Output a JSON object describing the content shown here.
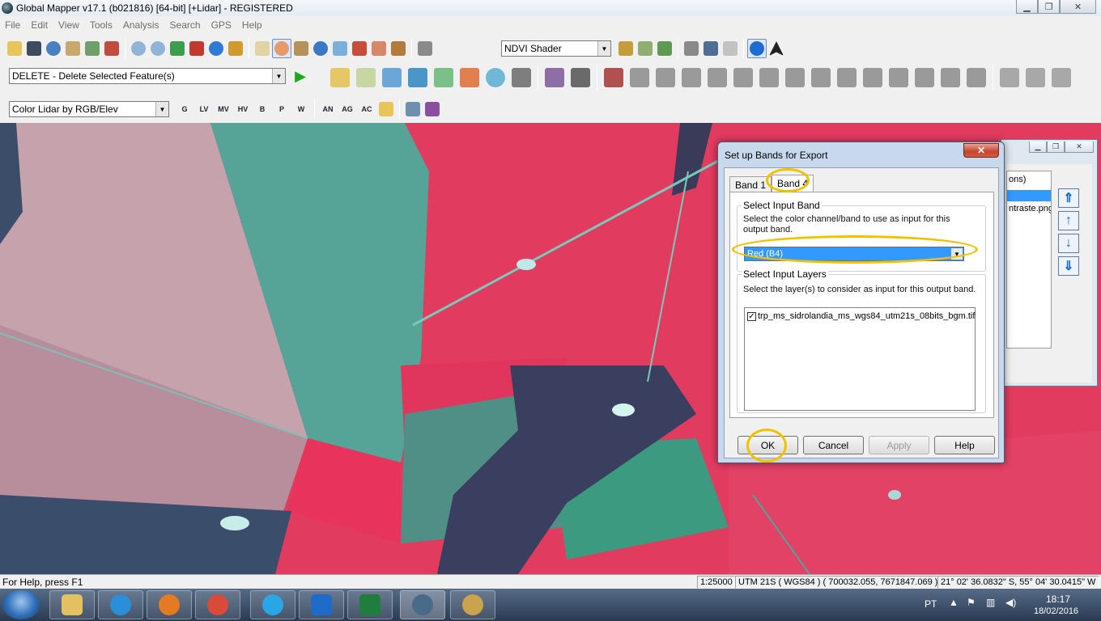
{
  "window": {
    "title": "Global Mapper v17.1 (b021816) [64-bit] [+Lidar] - REGISTERED",
    "minimize_glyph": "▁",
    "restore_glyph": "❐",
    "close_glyph": "✕"
  },
  "menu": [
    "File",
    "Edit",
    "View",
    "Tools",
    "Analysis",
    "Search",
    "GPS",
    "Help"
  ],
  "toolbar": {
    "shader_select": "NDVI Shader",
    "digitizer_select": "DELETE - Delete Selected Feature(s)",
    "lidar_select": "Color Lidar by RGB/Elev",
    "run_label": "▶",
    "lidar_buttons": [
      "G",
      "LV",
      "MV",
      "HV",
      "B",
      "P",
      "W"
    ],
    "lidar_buttons_2": [
      "AN",
      "AG",
      "AC"
    ]
  },
  "status": {
    "help": "For Help, press F1",
    "scale": "1:25000",
    "projection": "UTM 21S ( WGS84 ) ( 700032.055, 7671847.069 )",
    "latlon": "21° 02' 36.0832\" S, 55° 04' 30.0415\" W"
  },
  "background_window": {
    "col_text": "ons)",
    "item_text": "ntraste.png"
  },
  "dialog": {
    "title": "Set up Bands for Export",
    "close_glyph": "✕",
    "tabs": [
      "Band 1",
      "Band 4"
    ],
    "input_band": {
      "label": "Select Input Band",
      "description": "Select the color channel/band to use as input for this output band.",
      "selected": "Red (B4)"
    },
    "input_layers": {
      "label": "Select Input Layers",
      "description": "Select the layer(s) to consider as input for this output band.",
      "layers": [
        {
          "name": "trp_ms_sidrolandia_ms_wgs84_utm21s_08bits_bgm.tif",
          "checked": true,
          "mark": "✓"
        }
      ]
    },
    "buttons": {
      "ok": "OK",
      "cancel": "Cancel",
      "apply": "Apply",
      "help": "Help"
    }
  },
  "taskbar": {
    "language": "PT",
    "time": "18:17",
    "date": "18/02/2016"
  }
}
